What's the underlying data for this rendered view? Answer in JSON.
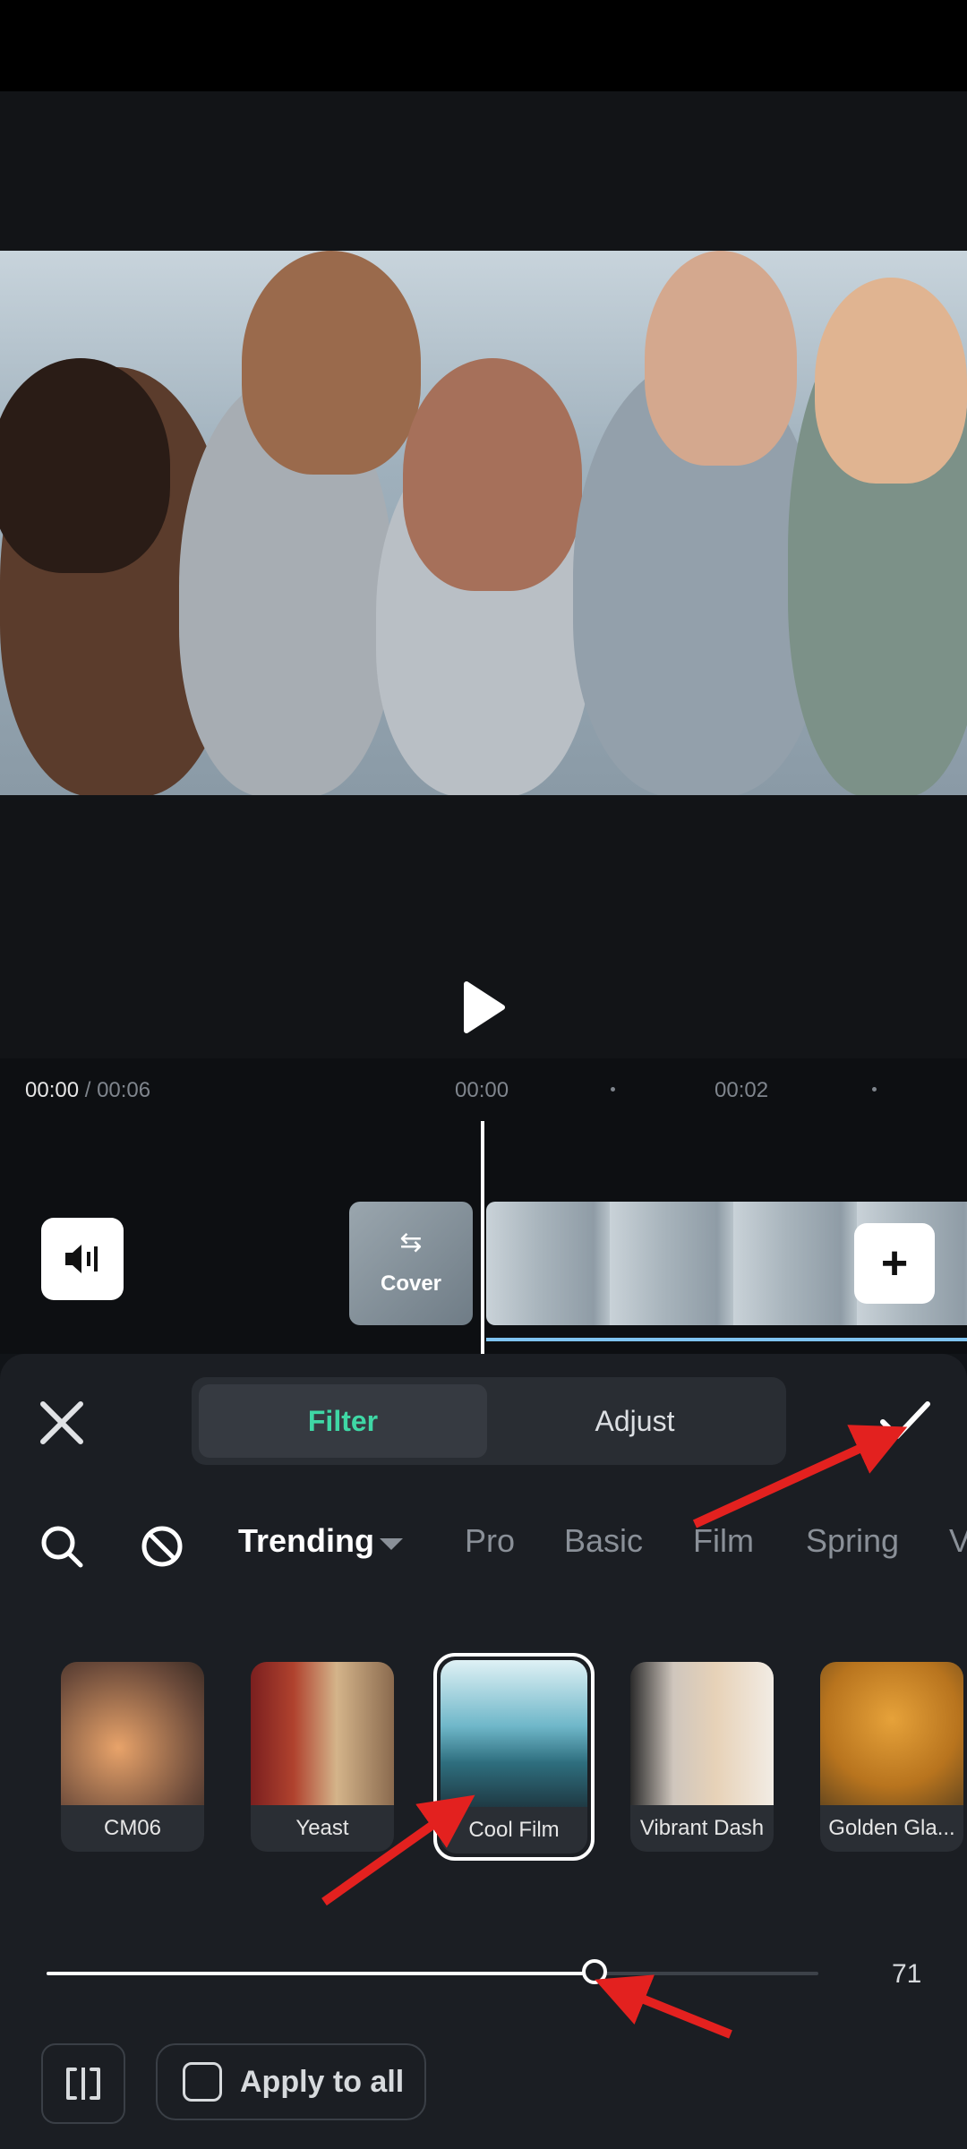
{
  "timeline": {
    "current_time": "00:00",
    "total_time": " / 00:06",
    "ruler_marks": [
      "00:00",
      "00:02"
    ]
  },
  "cover_label": "Cover",
  "tabs": [
    {
      "label": "Filter",
      "active": true
    },
    {
      "label": "Adjust",
      "active": false
    }
  ],
  "categories": {
    "active": "Trending",
    "items": [
      "Pro",
      "Basic",
      "Film",
      "Spring",
      "V"
    ]
  },
  "filters": [
    {
      "label": "CM06"
    },
    {
      "label": "Yeast"
    },
    {
      "label": "Cool Film",
      "selected": true
    },
    {
      "label": "Vibrant Dash"
    },
    {
      "label": "Golden Gla..."
    }
  ],
  "slider": {
    "value": "71",
    "fraction": 0.71
  },
  "apply_all_label": "Apply to all",
  "colors": {
    "accent": "#3fd7a5",
    "annotation_arrow": "#e3211f"
  },
  "icons": [
    "close-icon",
    "check-icon",
    "search-icon",
    "no-filter-icon",
    "volume-icon",
    "play-icon",
    "swap-icon",
    "plus-icon",
    "split-compare-icon"
  ]
}
